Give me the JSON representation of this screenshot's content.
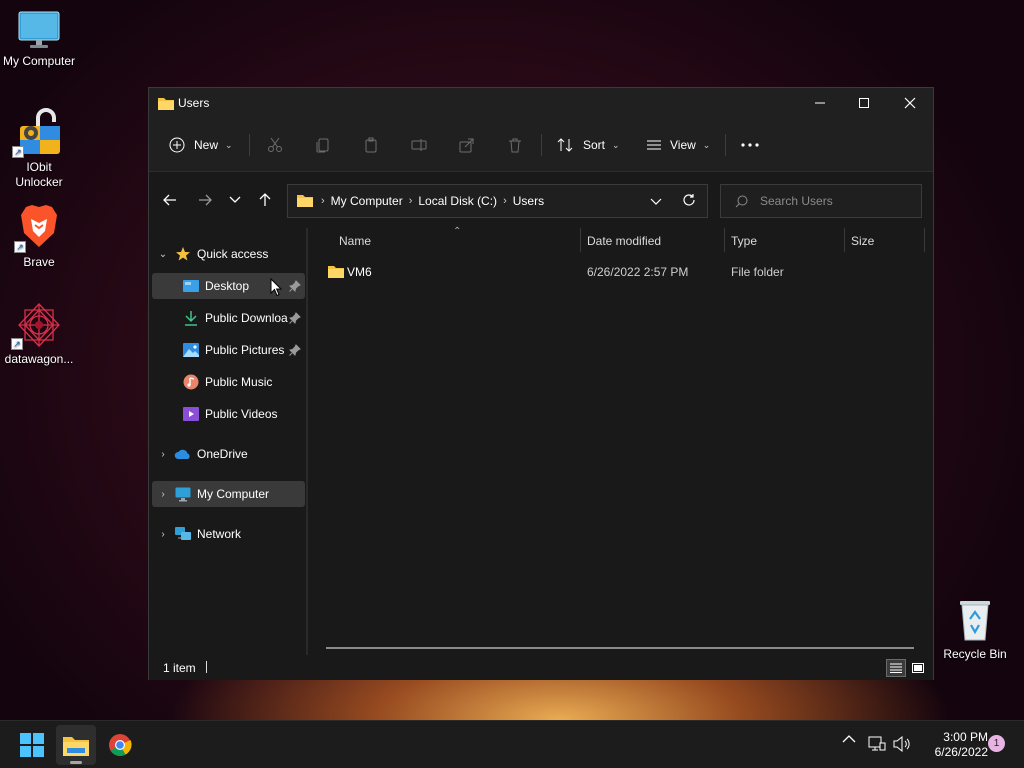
{
  "desktop": {
    "icons": [
      {
        "label": "My Computer"
      },
      {
        "label": "IObit Unlocker"
      },
      {
        "label": "Brave"
      },
      {
        "label": "datawagon..."
      },
      {
        "label": "Recycle Bin"
      }
    ]
  },
  "window": {
    "title": "Users",
    "toolbar": {
      "new_label": "New",
      "sort_label": "Sort",
      "view_label": "View"
    },
    "address": {
      "crumbs": [
        "My Computer",
        "Local Disk (C:)",
        "Users"
      ]
    },
    "search": {
      "placeholder": "Search Users"
    },
    "nav": {
      "quick_access": "Quick access",
      "items": [
        {
          "label": "Desktop"
        },
        {
          "label": "Public Downloa"
        },
        {
          "label": "Public Pictures"
        },
        {
          "label": "Public Music"
        },
        {
          "label": "Public Videos"
        }
      ],
      "onedrive": "OneDrive",
      "my_computer": "My Computer",
      "network": "Network"
    },
    "columns": {
      "name": "Name",
      "date": "Date modified",
      "type": "Type",
      "size": "Size"
    },
    "files": [
      {
        "name": "VM6",
        "date": "6/26/2022 2:57 PM",
        "type": "File folder",
        "size": ""
      }
    ],
    "status": {
      "count": "1 item"
    }
  },
  "taskbar": {
    "time": "3:00 PM",
    "date": "6/26/2022",
    "notifications": "1"
  },
  "colors": {
    "folder_yellow": "#f5c342",
    "accent_blue": "#3aa0e8"
  }
}
